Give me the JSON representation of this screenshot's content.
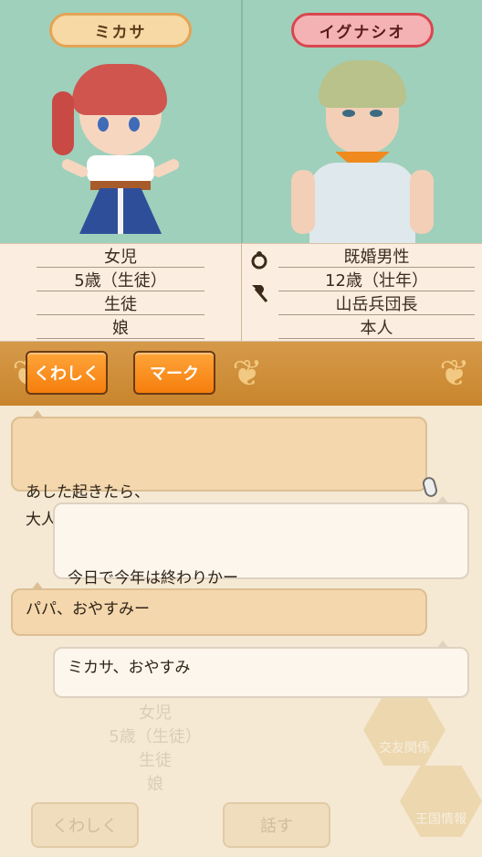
{
  "characters": {
    "left": {
      "name": "ミカサ",
      "rows": [
        "女児",
        "5歳（生徒）",
        "生徒",
        "娘"
      ]
    },
    "right": {
      "name": "イグナシオ",
      "rows": [
        "既婚男性",
        "12歳（壮年）",
        "山岳兵団長",
        "本人"
      ]
    }
  },
  "buttons": {
    "detail": "くわしく",
    "mark": "マーク"
  },
  "dialogue": [
    {
      "side": "left",
      "text": "あした起きたら、\n大人になってたりするかなー"
    },
    {
      "side": "right",
      "text": "今日で今年は終わりかー\n早いなー……"
    },
    {
      "side": "left",
      "text": "パパ、おやすみー"
    },
    {
      "side": "right",
      "text": "ミカサ、おやすみ"
    }
  ],
  "background": {
    "rows": [
      "女児",
      "5歳（生徒）",
      "生徒",
      "娘"
    ],
    "detail_button": "くわしく",
    "talk_button": "話す",
    "menu_friend": "交友関係",
    "menu_kingdom": "王国情報"
  },
  "colors": {
    "portrait_bg": "#9fd0bb",
    "button_orange": "#f57e0c",
    "bar": "#c9852c"
  }
}
